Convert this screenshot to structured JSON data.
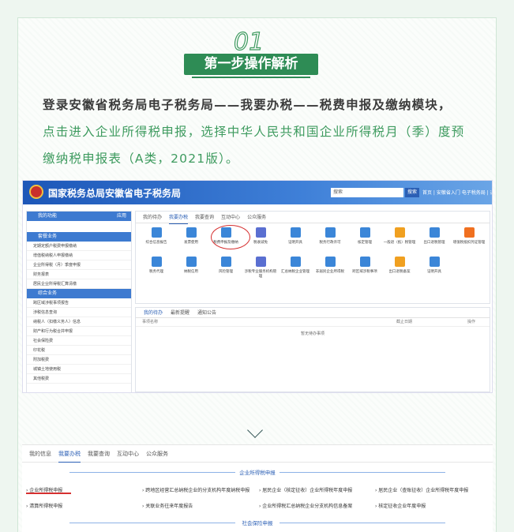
{
  "step": {
    "number": "01",
    "title": "第一步操作解析"
  },
  "intro": {
    "line1": "登录安徽省税务局电子税务局——我要办税——税费申报及缴纳模块，",
    "line2": "点击进入企业所得税申报，选择中华人民共和国企业所得税月（季）度预",
    "line3": "缴纳税申报表（A类，2021版）。"
  },
  "portal": {
    "site_name": "国家税务总局安徽省电子税务局",
    "search_placeholder": "搜索",
    "search_button": "搜索",
    "top_right": "首页 | 安徽省入门 电子税务局 | 退出",
    "side_header1": "我的功能",
    "side_header1_right": "应用",
    "side_header2": "套餐业务",
    "side_items1": [
      "定期定额户税费申报缴纳",
      "增值税纳税人申报缴纳",
      "企业所得税（月）季度申报",
      "财务报表",
      "居民企业所得税汇算清缴"
    ],
    "side_header3": "综合业务",
    "side_items2": [
      "跨区域涉税事项报告",
      "涉税信息查询",
      "纳税人（扣缴义务人）信息",
      "财产和行为税合并申报",
      "社会保险费",
      "印花税",
      "附加税费",
      "城镇土地使用税",
      "其他税费"
    ],
    "tabs": [
      "我的待办",
      "我要办税",
      "我要查询",
      "互动中心",
      "公众服务"
    ],
    "active_tab": "我要办税",
    "icons": [
      "综合信息报告",
      "发票使用",
      "税费申报及缴纳",
      "税收减免",
      "证明开具",
      "税务行政许可",
      "核定管理",
      "一般退（抵）税管理",
      "出口退税管理",
      "增值税抵扣凭证管理",
      "税务代理",
      "纳税信用",
      "风险管理",
      "涉税专业服务机构管理",
      "汇总纳税企业管理",
      "非居民企业所得税",
      "跨区域涉税事项",
      "出口退税备案",
      "证明开具"
    ],
    "lower_tabs": [
      "我的待办",
      "最新提醒",
      "通知公告"
    ],
    "lower_cols": [
      "事项名称",
      "截止日期",
      "操作"
    ],
    "lower_empty": "暂无待办事项"
  },
  "portal2": {
    "nav": [
      "我的信息",
      "我要办税",
      "我要查询",
      "互动中心",
      "公众服务"
    ],
    "active_nav": "我要办税",
    "section": "企业所得税申报",
    "items": [
      "企业所得税申报",
      "跨地区经营汇总纳税企业的分支机构年度纳税申报",
      "居民企业（核定征收）企业所得税年度申报",
      "居民企业（查账征收）企业所得税年度申报",
      "清算所得税申报",
      "关联业务往来年度报告",
      "企业所得税汇总纳税企业分支机构信息备案",
      "核定征收企业年度申报"
    ],
    "section2": "社会保险申报"
  },
  "colors": {
    "green": "#2e8c55",
    "blue": "#2b5fb5",
    "red": "#d63030"
  }
}
